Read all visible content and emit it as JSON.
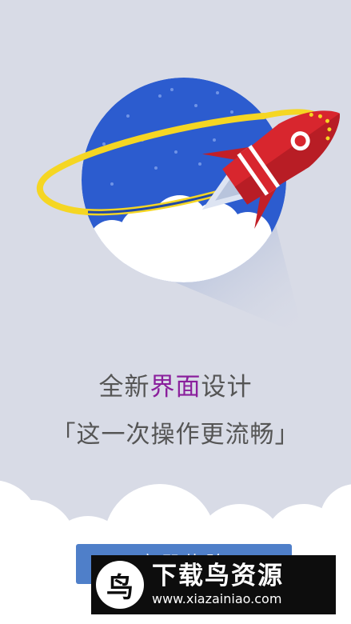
{
  "headline": {
    "part1": "全新",
    "accent": "界面",
    "part2": "设计"
  },
  "subline": "「这一次操作更流畅」",
  "cta": {
    "label": "立即体验"
  },
  "watermark": {
    "logo_glyph": "鸟",
    "title": "下载鸟资源",
    "url": "www.xiazainiao.com"
  },
  "colors": {
    "background": "#d8dbe6",
    "planet": "#2c5ccf",
    "ring": "#f5d623",
    "rocket": "#d8262e",
    "accent_text": "#8a1f9c",
    "button": "#4f7fc9"
  },
  "icons": [
    "moon-icon",
    "rocket-icon",
    "planet-illustration"
  ]
}
